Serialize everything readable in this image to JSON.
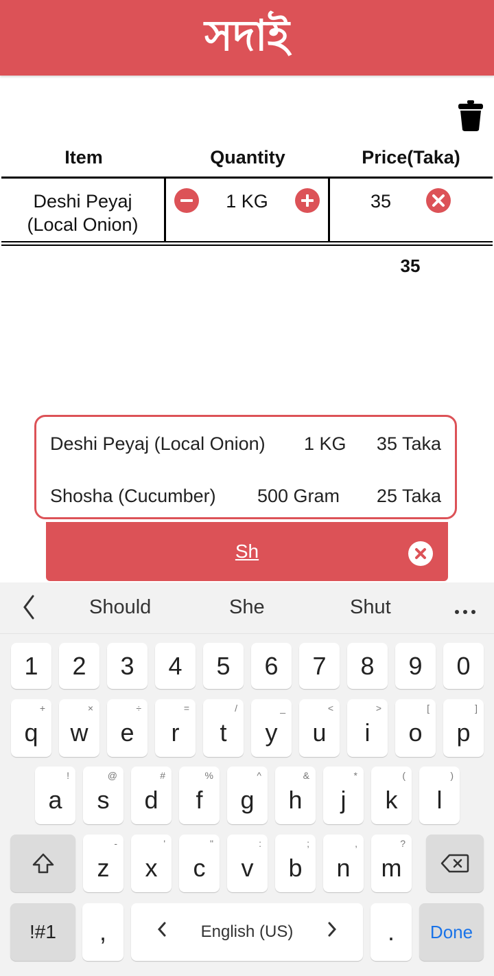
{
  "app": {
    "title": "সদাই"
  },
  "table": {
    "headers": {
      "item": "Item",
      "quantity": "Quantity",
      "price": "Price(Taka)"
    },
    "rows": [
      {
        "item_line1": "Deshi Peyaj",
        "item_line2": "(Local Onion)",
        "quantity": "1 KG",
        "price": "35"
      }
    ],
    "total": "35"
  },
  "suggestions": [
    {
      "name": "Deshi Peyaj (Local Onion)",
      "quantity": "1 KG",
      "price": "35 Taka"
    },
    {
      "name": "Shosha (Cucumber)",
      "quantity": "500 Gram",
      "price": "25 Taka"
    }
  ],
  "search": {
    "value": "Sh"
  },
  "keyboard": {
    "predictions": [
      "Should",
      "She",
      "Shut"
    ],
    "numbers": [
      "1",
      "2",
      "3",
      "4",
      "5",
      "6",
      "7",
      "8",
      "9",
      "0"
    ],
    "row1": [
      {
        "k": "q",
        "s": "+"
      },
      {
        "k": "w",
        "s": "×"
      },
      {
        "k": "e",
        "s": "÷"
      },
      {
        "k": "r",
        "s": "="
      },
      {
        "k": "t",
        "s": "/"
      },
      {
        "k": "y",
        "s": "_"
      },
      {
        "k": "u",
        "s": "<"
      },
      {
        "k": "i",
        "s": ">"
      },
      {
        "k": "o",
        "s": "["
      },
      {
        "k": "p",
        "s": "]"
      }
    ],
    "row2": [
      {
        "k": "a",
        "s": "!"
      },
      {
        "k": "s",
        "s": "@"
      },
      {
        "k": "d",
        "s": "#"
      },
      {
        "k": "f",
        "s": "%"
      },
      {
        "k": "g",
        "s": "^"
      },
      {
        "k": "h",
        "s": "&"
      },
      {
        "k": "j",
        "s": "*"
      },
      {
        "k": "k",
        "s": "("
      },
      {
        "k": "l",
        "s": ")"
      }
    ],
    "row3": [
      {
        "k": "z",
        "s": "-"
      },
      {
        "k": "x",
        "s": "'"
      },
      {
        "k": "c",
        "s": "\""
      },
      {
        "k": "v",
        "s": ":"
      },
      {
        "k": "b",
        "s": ";"
      },
      {
        "k": "n",
        "s": ","
      },
      {
        "k": "m",
        "s": "?"
      }
    ],
    "symbols_label": "!#1",
    "comma": ",",
    "language": "English (US)",
    "period": ".",
    "done_label": "Done"
  },
  "colors": {
    "accent": "#DC5257",
    "done": "#1A73E8"
  }
}
